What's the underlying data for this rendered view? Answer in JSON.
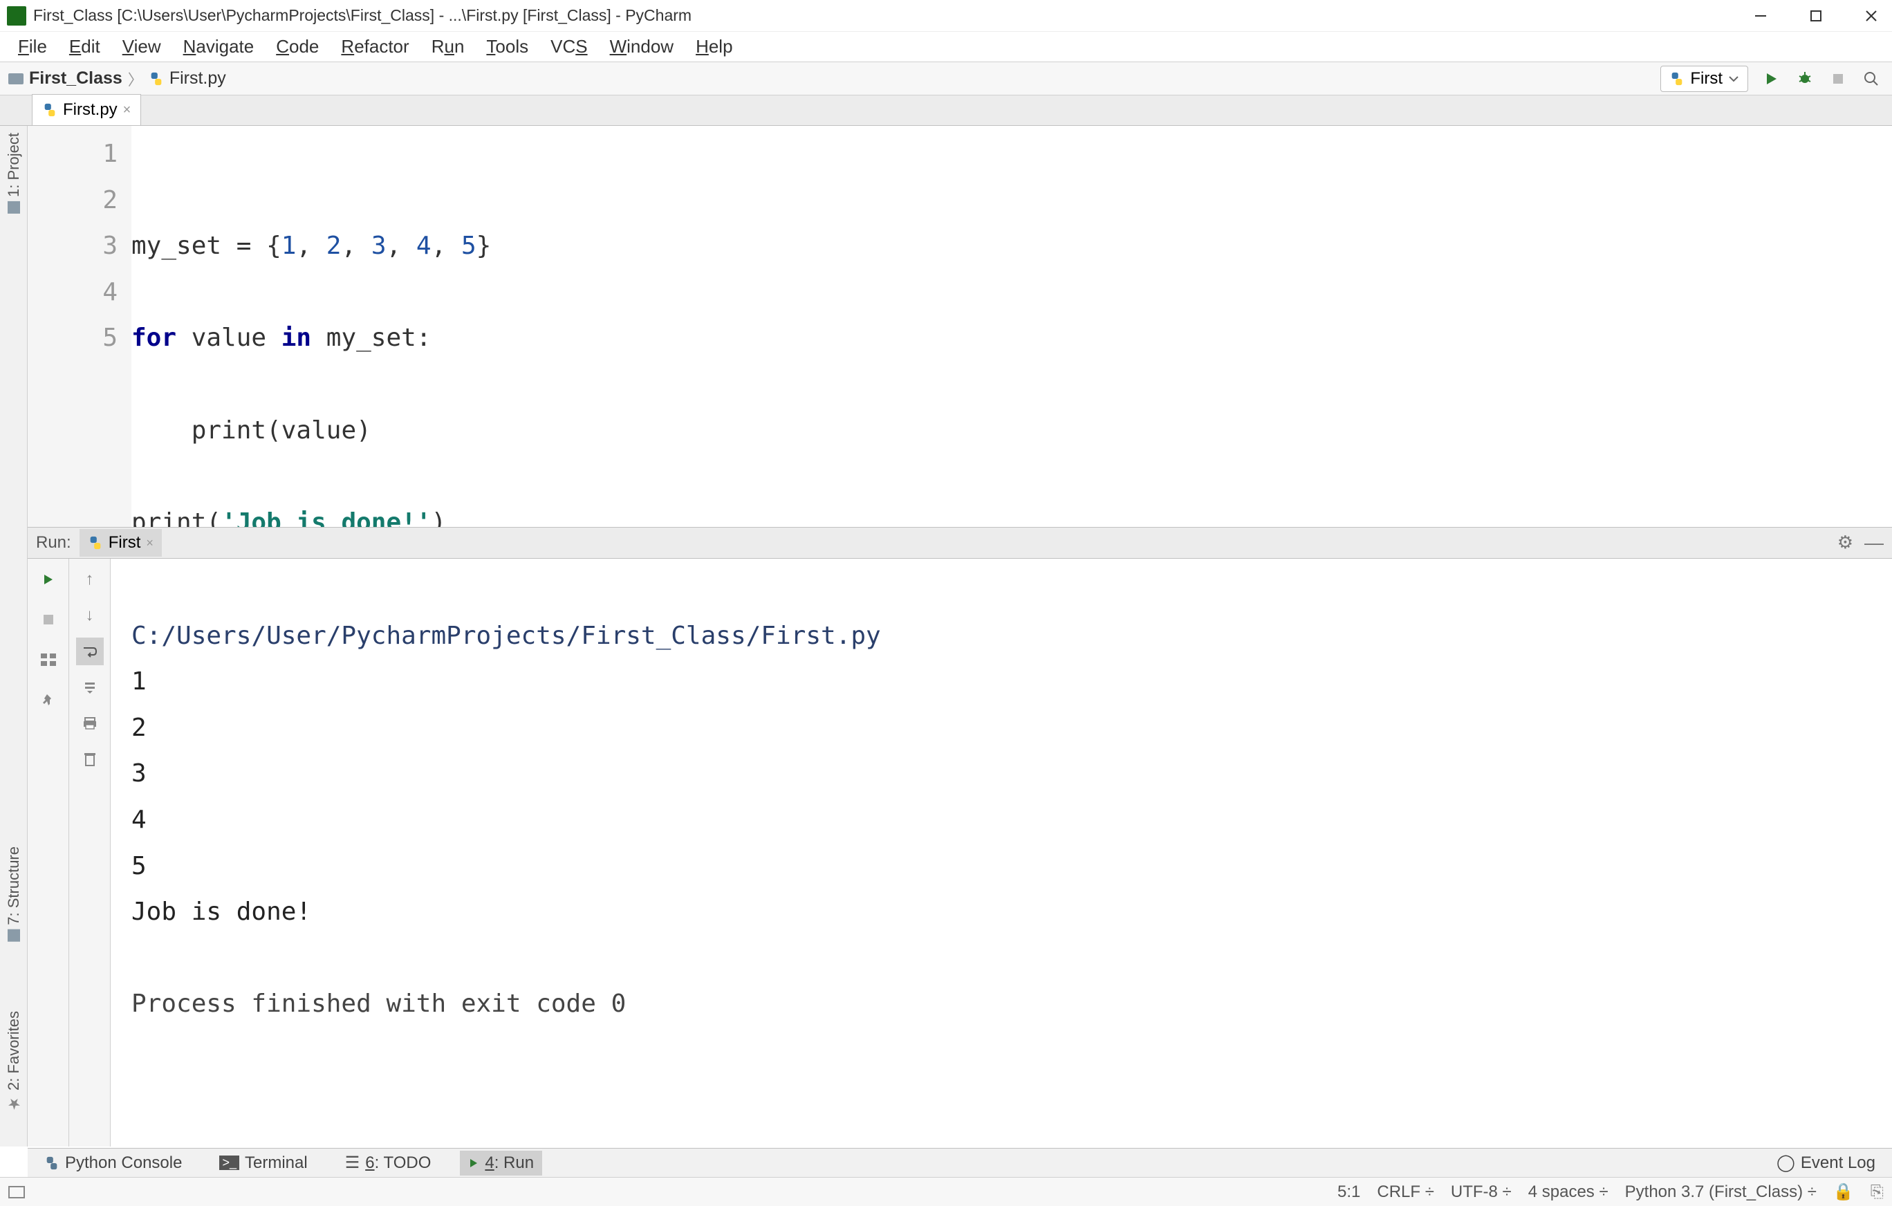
{
  "window": {
    "title": "First_Class [C:\\Users\\User\\PycharmProjects\\First_Class] - ...\\First.py [First_Class] - PyCharm"
  },
  "menu": {
    "file": "File",
    "edit": "Edit",
    "view": "View",
    "navigate": "Navigate",
    "code": "Code",
    "refactor": "Refactor",
    "run": "Run",
    "tools": "Tools",
    "vcs": "VCS",
    "window": "Window",
    "help": "Help"
  },
  "breadcrumb": {
    "project": "First_Class",
    "file": "First.py"
  },
  "run_config": {
    "name": "First"
  },
  "editor_tab": {
    "name": "First.py"
  },
  "code": {
    "line1": {
      "a": "my_set = {",
      "n1": "1",
      "c1": ", ",
      "n2": "2",
      "c2": ", ",
      "n3": "3",
      "c3": ", ",
      "n4": "4",
      "c4": ", ",
      "n5": "5",
      "b": "}"
    },
    "line2": {
      "kw1": "for",
      "sp1": " value ",
      "kw2": "in",
      "sp2": " my_set:"
    },
    "line3": {
      "indent": "    ",
      "fn": "print",
      "rest": "(value)"
    },
    "line4": {
      "fn": "print",
      "p1": "(",
      "str": "'Job is done!'",
      "p2": ")"
    },
    "gutter": {
      "l1": "1",
      "l2": "2",
      "l3": "3",
      "l4": "4",
      "l5": "5"
    }
  },
  "run": {
    "label": "Run:",
    "tab": "First",
    "path": "C:/Users/User/PycharmProjects/First_Class/First.py",
    "out1": "1",
    "out2": "2",
    "out3": "3",
    "out4": "4",
    "out5": "5",
    "out6": "Job is done!",
    "exit": "Process finished with exit code 0"
  },
  "left_rail": {
    "project": "1: Project",
    "structure": "7: Structure",
    "favorites": "2: Favorites"
  },
  "bottom": {
    "python_console": "Python Console",
    "terminal": "Terminal",
    "todo": "6: TODO",
    "run": "4: Run",
    "event_log": "Event Log"
  },
  "status": {
    "pos": "5:1",
    "line_sep": "CRLF",
    "encoding": "UTF-8",
    "indent": "4 spaces",
    "interpreter": "Python 3.7 (First_Class)"
  }
}
